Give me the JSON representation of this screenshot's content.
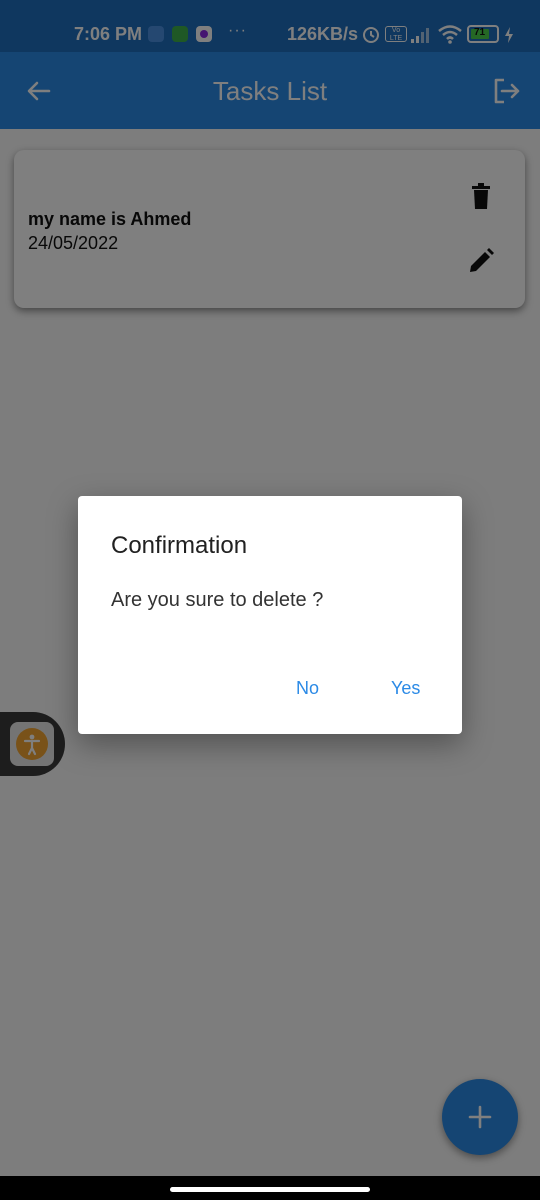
{
  "status_bar": {
    "time": "7:06 PM",
    "dots": "···",
    "network_speed": "126KB/s",
    "volte": "Vo LTE",
    "battery": "71"
  },
  "app_bar": {
    "title": "Tasks List",
    "back_icon": "arrow-left-icon",
    "logout_icon": "logout-icon"
  },
  "tasks": [
    {
      "title": "my name is Ahmed",
      "date": "24/05/2022"
    }
  ],
  "dialog": {
    "title": "Confirmation",
    "message": "Are you sure to delete ?",
    "no_label": "No",
    "yes_label": "Yes"
  },
  "fab": {
    "icon": "plus-icon"
  },
  "colors": {
    "primary": "#2b8ae6",
    "status_bar": "#1f6fbf",
    "accessibility_accent": "#f2a532"
  }
}
